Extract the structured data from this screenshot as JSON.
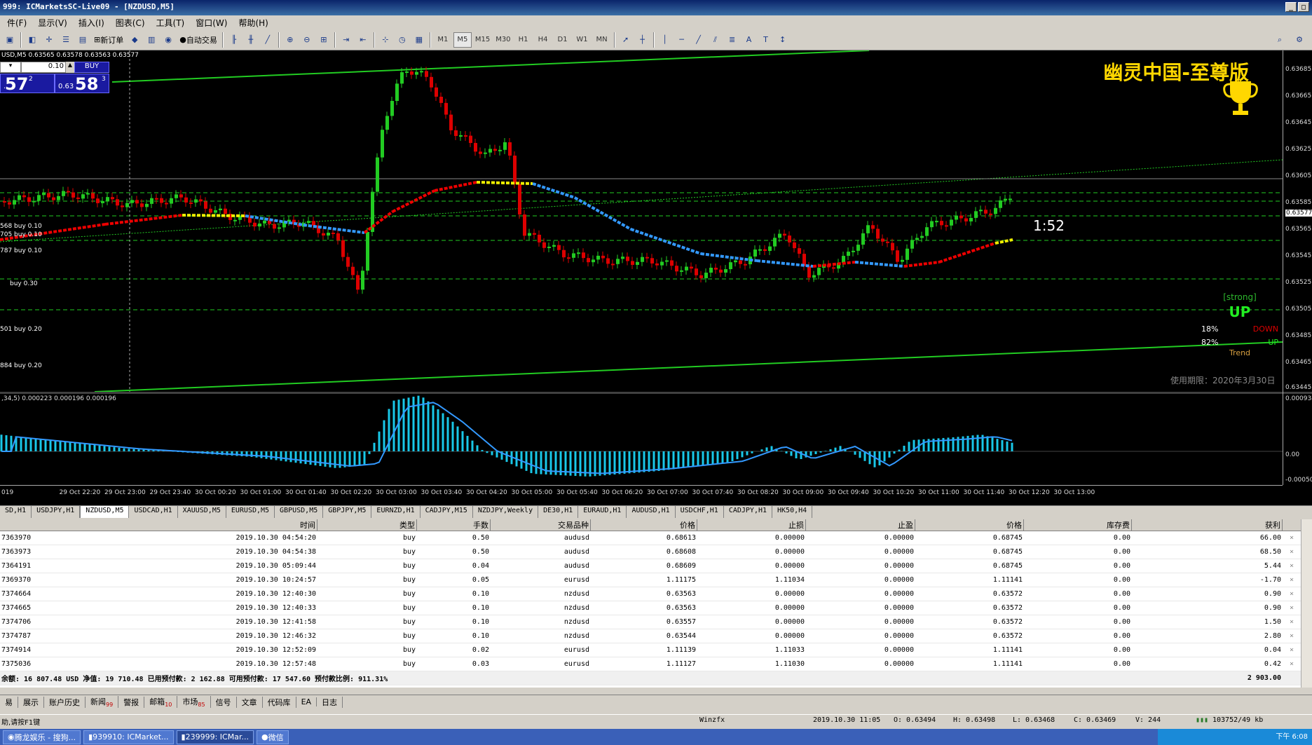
{
  "title": "999: ICMarketsSC-Live09 - [NZDUSD,M5]",
  "menu": [
    "件(F)",
    "显示(V)",
    "插入(I)",
    "图表(C)",
    "工具(T)",
    "窗口(W)",
    "帮助(H)"
  ],
  "toolbar": {
    "new_order": "新订单",
    "auto_trade": "自动交易",
    "timeframes": [
      "M1",
      "M5",
      "M15",
      "M30",
      "H1",
      "H4",
      "D1",
      "W1",
      "MN"
    ],
    "active_timeframe": "M5"
  },
  "chart": {
    "symbol_line": "USD,M5  0.63565 0.63578 0.63563 0.63577",
    "one_click": {
      "lot": "0.10",
      "buy_label": "BUY",
      "sell_price_big": "57",
      "sell_price_sup": "2",
      "buy_price_small": "0.63",
      "buy_price_big": "58",
      "buy_price_sup": "3",
      "sell_price_prefix": "."
    },
    "brand": "幽灵中国-至尊版",
    "timer": "1:52",
    "trend": {
      "strong": "[strong]",
      "direction": "UP",
      "down_pct": "18%",
      "down_label": "DOWN",
      "up_pct": "82%",
      "up_label": "UP",
      "trend_label": "Trend"
    },
    "usage": "使用期限：2020年3月30日",
    "positions": [
      "568 buy 0.10",
      "705 buy 0.10",
      "787 buy 0.10",
      "buy 0.30",
      "501 buy 0.20",
      "884 buy 0.20"
    ],
    "price_ticks": [
      "0.63685",
      "0.63665",
      "0.63645",
      "0.63625",
      "0.63605",
      "0.63585",
      "0.63577",
      "0.63565",
      "0.63545",
      "0.63525",
      "0.63505",
      "0.63485",
      "0.63465",
      "0.63445"
    ],
    "osc_label": ",34,5) 0.000223 0.000196 0.000196",
    "osc_ticks": [
      "0.000934",
      "0.00",
      "-0.000504"
    ],
    "time_ticks": [
      "019",
      "29 Oct 22:20",
      "29 Oct 23:00",
      "29 Oct 23:40",
      "30 Oct 00:20",
      "30 Oct 01:00",
      "30 Oct 01:40",
      "30 Oct 02:20",
      "30 Oct 03:00",
      "30 Oct 03:40",
      "30 Oct 04:20",
      "30 Oct 05:00",
      "30 Oct 05:40",
      "30 Oct 06:20",
      "30 Oct 07:00",
      "30 Oct 07:40",
      "30 Oct 08:20",
      "30 Oct 09:00",
      "30 Oct 09:40",
      "30 Oct 10:20",
      "30 Oct 11:00",
      "30 Oct 11:40",
      "30 Oct 12:20",
      "30 Oct 13:00"
    ]
  },
  "chart_tabs": [
    "SD,H1",
    "USDJPY,H1",
    "NZDUSD,M5",
    "USDCAD,H1",
    "XAUUSD,M5",
    "EURUSD,M5",
    "GBPUSD,M5",
    "GBPJPY,M5",
    "EURNZD,H1",
    "CADJPY,M15",
    "NZDJPY,Weekly",
    "DE30,H1",
    "EURAUD,H1",
    "AUDUSD,H1",
    "USDCHF,H1",
    "CADJPY,H1",
    "HK50,H4"
  ],
  "active_chart_tab": "NZDUSD,M5",
  "orders": {
    "headers": [
      "",
      "时间",
      "类型",
      "手数",
      "交易品种",
      "价格",
      "止损",
      "止盈",
      "价格",
      "库存费",
      "获利"
    ],
    "rows": [
      [
        "7363970",
        "2019.10.30 04:54:20",
        "buy",
        "0.50",
        "audusd",
        "0.68613",
        "0.00000",
        "0.00000",
        "0.68745",
        "0.00",
        "66.00"
      ],
      [
        "7363973",
        "2019.10.30 04:54:38",
        "buy",
        "0.50",
        "audusd",
        "0.68608",
        "0.00000",
        "0.00000",
        "0.68745",
        "0.00",
        "68.50"
      ],
      [
        "7364191",
        "2019.10.30 05:09:44",
        "buy",
        "0.04",
        "audusd",
        "0.68609",
        "0.00000",
        "0.00000",
        "0.68745",
        "0.00",
        "5.44"
      ],
      [
        "7369370",
        "2019.10.30 10:24:57",
        "buy",
        "0.05",
        "eurusd",
        "1.11175",
        "1.11034",
        "0.00000",
        "1.11141",
        "0.00",
        "-1.70"
      ],
      [
        "7374664",
        "2019.10.30 12:40:30",
        "buy",
        "0.10",
        "nzdusd",
        "0.63563",
        "0.00000",
        "0.00000",
        "0.63572",
        "0.00",
        "0.90"
      ],
      [
        "7374665",
        "2019.10.30 12:40:33",
        "buy",
        "0.10",
        "nzdusd",
        "0.63563",
        "0.00000",
        "0.00000",
        "0.63572",
        "0.00",
        "0.90"
      ],
      [
        "7374706",
        "2019.10.30 12:41:58",
        "buy",
        "0.10",
        "nzdusd",
        "0.63557",
        "0.00000",
        "0.00000",
        "0.63572",
        "0.00",
        "1.50"
      ],
      [
        "7374787",
        "2019.10.30 12:46:32",
        "buy",
        "0.10",
        "nzdusd",
        "0.63544",
        "0.00000",
        "0.00000",
        "0.63572",
        "0.00",
        "2.80"
      ],
      [
        "7374914",
        "2019.10.30 12:52:09",
        "buy",
        "0.02",
        "eurusd",
        "1.11139",
        "1.11033",
        "0.00000",
        "1.11141",
        "0.00",
        "0.04"
      ],
      [
        "7375036",
        "2019.10.30 12:57:48",
        "buy",
        "0.03",
        "eurusd",
        "1.11127",
        "1.11030",
        "0.00000",
        "1.11141",
        "0.00",
        "0.42"
      ]
    ],
    "balance_line": "余额: 16 807.48 USD  净值: 19 710.48  已用预付款: 2 162.88  可用预付款: 17 547.60  预付款比例: 911.31%",
    "total_profit": "2 903.00"
  },
  "bottom_tabs": [
    {
      "label": "易",
      "badge": ""
    },
    {
      "label": "展示",
      "badge": ""
    },
    {
      "label": "账户历史",
      "badge": ""
    },
    {
      "label": "新闻",
      "badge": "99"
    },
    {
      "label": "警报",
      "badge": ""
    },
    {
      "label": "邮箱",
      "badge": "10"
    },
    {
      "label": "市场",
      "badge": "85"
    },
    {
      "label": "信号",
      "badge": ""
    },
    {
      "label": "文章",
      "badge": ""
    },
    {
      "label": "代码库",
      "badge": ""
    },
    {
      "label": "EA",
      "badge": ""
    },
    {
      "label": "日志",
      "badge": ""
    }
  ],
  "status": {
    "help": "助,请按F1键",
    "profile": "Winzfx",
    "datetime": "2019.10.30 11:05",
    "open": "O: 0.63494",
    "high": "H: 0.63498",
    "low": "L: 0.63468",
    "close": "C: 0.63469",
    "volume": "V: 244",
    "traffic": "103752/49 kb"
  },
  "taskbar": {
    "items": [
      "腾龙娱乐 - 搜狗...",
      "939910: ICMarket...",
      "239999: ICMar...",
      "微信"
    ],
    "clock_period": "下午",
    "clock_time": "6:08"
  },
  "colors": {
    "bull": "#22cc22",
    "bear": "#dd0000",
    "ma_up": "#ee0000",
    "ma_down": "#3399ff",
    "ma_flat": "#eeee00",
    "channel": "#22cc22",
    "osc_bar": "#19c8e8"
  }
}
